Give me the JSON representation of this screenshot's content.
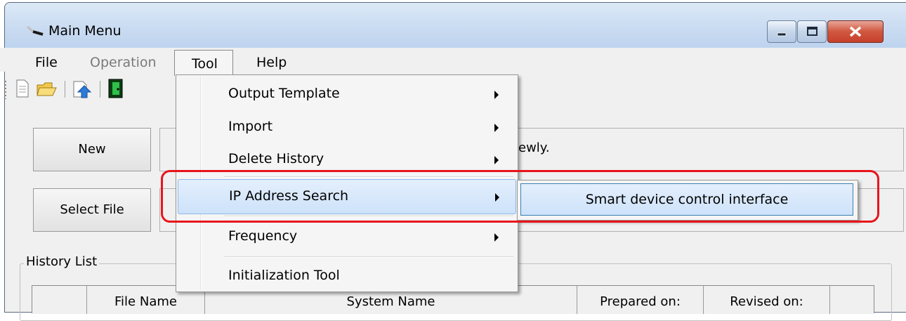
{
  "window": {
    "title": "Main Menu"
  },
  "menubar": {
    "items": [
      {
        "label": "File",
        "enabled": true
      },
      {
        "label": "Operation",
        "enabled": false
      },
      {
        "label": "Tool",
        "enabled": true,
        "open": true
      },
      {
        "label": "Help",
        "enabled": true
      }
    ]
  },
  "toolbar": {
    "icons": [
      "new-document-icon",
      "open-folder-icon",
      "upload-icon",
      "exit-icon"
    ]
  },
  "main": {
    "new_button": "New",
    "new_desc": "ewly.",
    "select_file_button": "Select File",
    "history_label": "History List",
    "history_columns": [
      "",
      "File Name",
      "System Name",
      "Prepared on:",
      "Revised on:",
      ""
    ]
  },
  "tool_menu": {
    "items": [
      {
        "label": "Output Template",
        "submenu": true
      },
      {
        "label": "Import",
        "submenu": true
      },
      {
        "label": "Delete History",
        "submenu": true
      },
      {
        "label": "IP Address Search",
        "submenu": true,
        "highlighted": true
      },
      {
        "label": "Frequency",
        "submenu": true
      },
      {
        "label": "Initialization Tool",
        "submenu": false
      }
    ]
  },
  "ip_submenu": {
    "items": [
      {
        "label": "Smart device control interface",
        "highlighted": true
      }
    ]
  },
  "colors": {
    "callout": "#e8141c",
    "highlight_border": "#8eb8ea",
    "titlebar": "#c9dbf1",
    "close_button": "#c7412c"
  }
}
